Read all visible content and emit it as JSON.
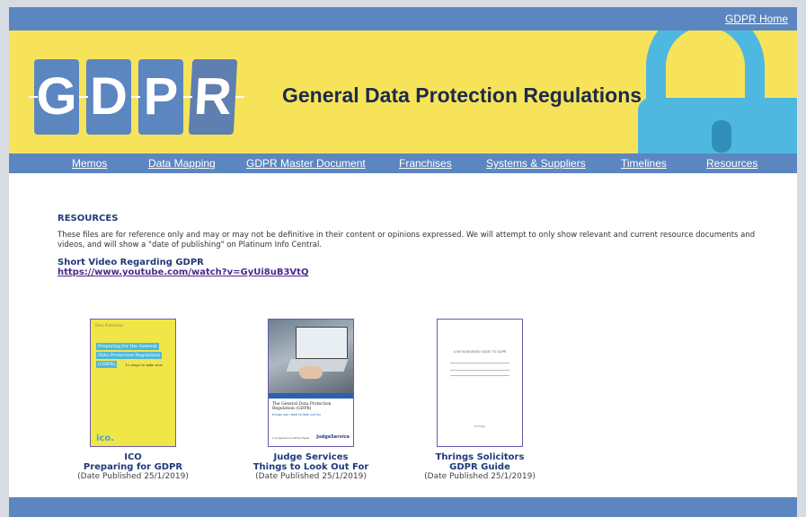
{
  "header": {
    "home_link": "GDPR Home",
    "logo_letters": [
      "G",
      "D",
      "P",
      "R"
    ],
    "banner_title": "General Data Protection Regulations"
  },
  "nav": {
    "items": [
      {
        "label": "Memos"
      },
      {
        "label": "Data Mapping"
      },
      {
        "label": "GDPR Master Document"
      },
      {
        "label": "Franchises"
      },
      {
        "label": "Systems & Suppliers"
      },
      {
        "label": "Timelines"
      },
      {
        "label": "Resources"
      }
    ]
  },
  "resources": {
    "heading": "RESOURCES",
    "description": "These files are for reference only and may or may not be definitive in their content or opinions expressed. We will attempt to only show relevant and current resource documents and videos, and will show a \"date of publishing\" on Platinum Info Central.",
    "video_title": "Short Video Regarding GDPR",
    "video_link": "https://www.youtube.com/watch?v=GyUi8uB3VtQ"
  },
  "documents": [
    {
      "title_line1": "ICO",
      "title_line2": "Preparing for GDPR",
      "date": "(Date Published 25/1/2019)",
      "cover": {
        "small_text": "Data Protection",
        "highlight1": "Preparing for the General",
        "highlight2": "Data Protection Regulation",
        "highlight3": "(GDPR)",
        "steps": "12 steps to take now",
        "logo": "ico."
      }
    },
    {
      "title_line1": "Judge Services",
      "title_line2": "Things to Look Out For",
      "date": "(Date Published 25/1/2019)",
      "cover": {
        "title": "The General Data Protection Regulation (GDPR)",
        "subtitle": "things you need to look out for",
        "footer": "A JudgeService White Paper",
        "brand": "JudgeService"
      }
    },
    {
      "title_line1": "Thrings Solicitors",
      "title_line2": "GDPR Guide",
      "date": "(Date Published 25/1/2019)",
      "cover": {
        "title": "A NO NONSENSE GUIDE TO GDPR",
        "footer": "thrings"
      }
    }
  ],
  "colors": {
    "bar": "#5b86c0",
    "banner": "#f7e35a",
    "heading": "#1f3a7a",
    "link": "#4a2a8a"
  }
}
